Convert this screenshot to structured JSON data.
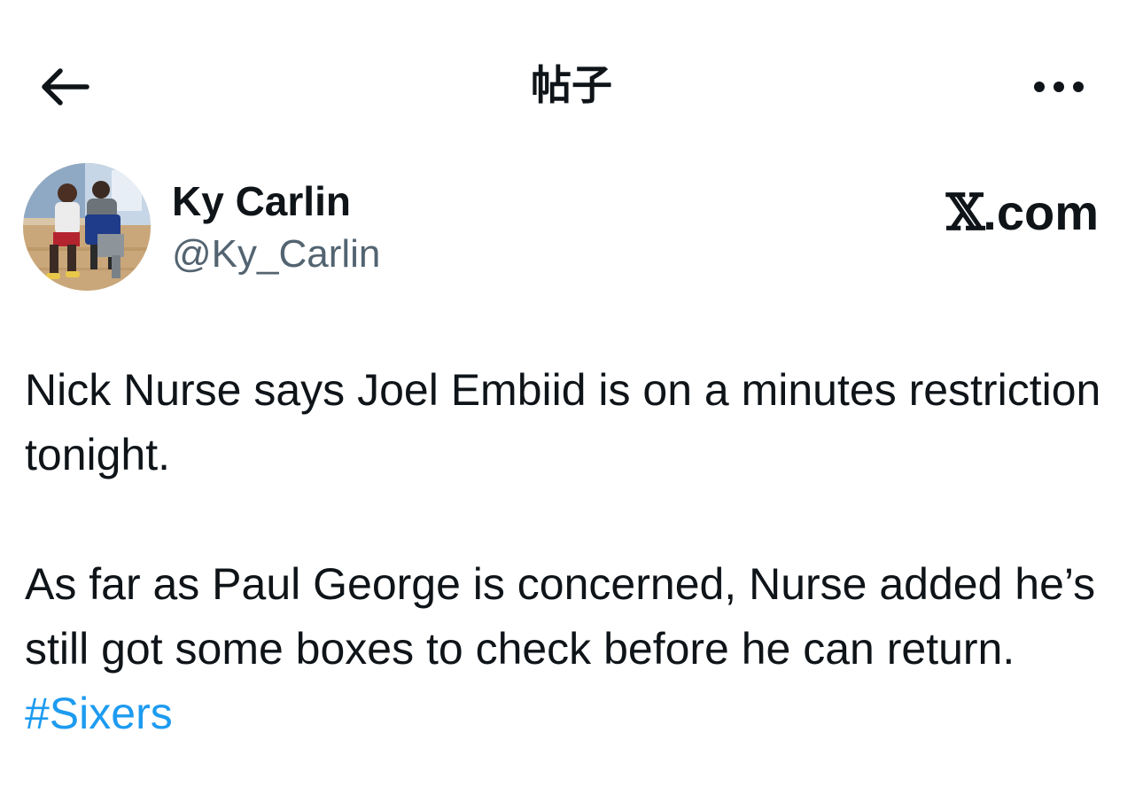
{
  "header": {
    "title": "帖子",
    "back_icon": "arrow-left-icon",
    "more_icon": "more-horizontal-icon"
  },
  "author": {
    "display_name": "Ky Carlin",
    "handle": "@Ky_Carlin",
    "source_x": "𝕏",
    "source_domain": ".com"
  },
  "tweet": {
    "paragraph1": "Nick Nurse says Joel Embiid is on a minutes restriction tonight.",
    "paragraph2_text": "As far as Paul George is concerned, Nurse added he’s still got some boxes to check before he can return. ",
    "hashtag": "#Sixers"
  },
  "colors": {
    "text": "#0f1419",
    "secondary_text": "#536471",
    "link": "#1d9bf0",
    "background": "#ffffff"
  }
}
